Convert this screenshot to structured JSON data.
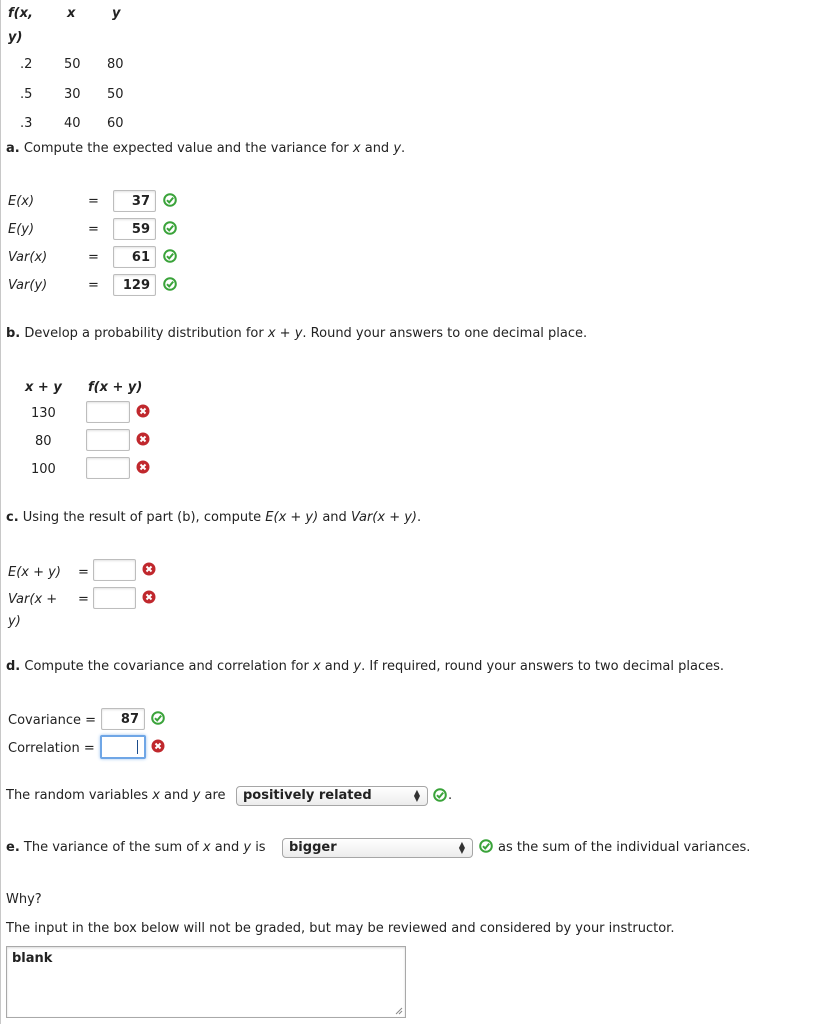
{
  "table": {
    "headers": {
      "f": "f(x,",
      "f2": "y)",
      "x": "x",
      "y": "y"
    },
    "rows": [
      {
        "f": ".2",
        "x": "50",
        "y": "80"
      },
      {
        "f": ".5",
        "x": "30",
        "y": "50"
      },
      {
        "f": ".3",
        "x": "40",
        "y": "60"
      }
    ]
  },
  "part_a": {
    "letter": "a.",
    "prompt_1": "Compute the expected value and the variance for ",
    "x": "x",
    "and": " and ",
    "y": "y",
    "end": ".",
    "rows": [
      {
        "label": "E(x)",
        "eq": "=",
        "value": "37",
        "status": "correct"
      },
      {
        "label": "E(y)",
        "eq": "=",
        "value": "59",
        "status": "correct"
      },
      {
        "label": "Var(x)",
        "eq": "=",
        "value": "61",
        "status": "correct"
      },
      {
        "label": "Var(y)",
        "eq": "=",
        "value": "129",
        "status": "correct"
      }
    ]
  },
  "part_b": {
    "letter": "b.",
    "prompt_1": "Develop a probability distribution for ",
    "xy": "x + y",
    "prompt_2": ". Round your answers to one decimal place.",
    "col_sum": "x + y",
    "col_f": "f(x + y)",
    "rows": [
      {
        "sum": "130",
        "value": "",
        "status": "incorrect"
      },
      {
        "sum": "80",
        "value": "",
        "status": "incorrect"
      },
      {
        "sum": "100",
        "value": "",
        "status": "incorrect"
      }
    ]
  },
  "part_c": {
    "letter": "c.",
    "prompt_1": "Using the result of part (b), compute ",
    "exy": "E(x + y)",
    "and": " and ",
    "varxy": "Var(x + y)",
    "end": ".",
    "rows": [
      {
        "label": "E(x + y)",
        "label2": "",
        "eq": "=",
        "value": "",
        "status": "incorrect"
      },
      {
        "label": "Var(x +",
        "label2": "y)",
        "eq": "=",
        "value": "",
        "status": "incorrect"
      }
    ]
  },
  "part_d": {
    "letter": "d.",
    "prompt_1": "Compute the covariance and correlation for ",
    "x": "x",
    "and": " and ",
    "y": "y",
    "prompt_2": ". If required, round your answers to two decimal places.",
    "covariance_label": "Covariance =",
    "covariance_value": "87",
    "covariance_status": "correct",
    "correlation_label": "Correlation =",
    "correlation_value": "",
    "correlation_status": "incorrect",
    "related_1": "The random variables ",
    "related_x": "x",
    "related_and": " and ",
    "related_y": "y",
    "related_are": " are",
    "related_select": "positively related",
    "related_status": "correct",
    "related_end": "."
  },
  "part_e": {
    "letter": "e.",
    "prompt_1": "The variance of the sum of ",
    "x": "x",
    "and": " and ",
    "y": "y",
    "is": " is",
    "select": "bigger",
    "status": "correct",
    "after": "as the sum of the individual variances."
  },
  "why": {
    "label": "Why?",
    "note": "The input in the box below will not be graded, but may be reviewed and considered by your instructor.",
    "textarea_value": "blank"
  },
  "colors": {
    "correct": "#3aa33a",
    "incorrect": "#c0282d",
    "focus": "#6fa6e6"
  }
}
